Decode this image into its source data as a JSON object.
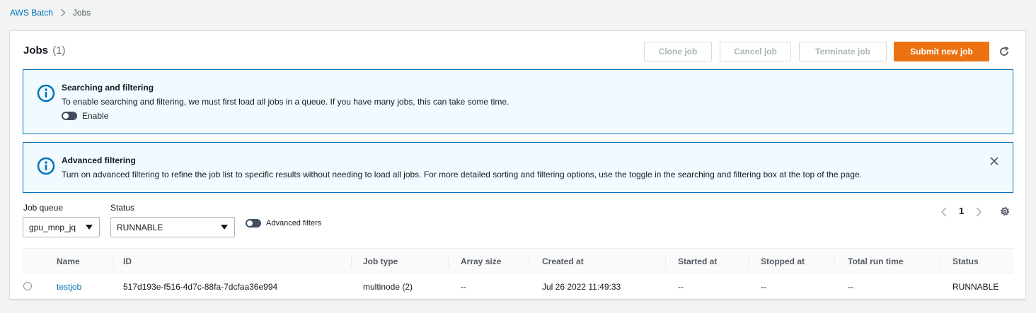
{
  "breadcrumb": {
    "root": "AWS Batch",
    "current": "Jobs"
  },
  "panel": {
    "title": "Jobs",
    "count": "(1)"
  },
  "buttons": {
    "clone": "Clone job",
    "cancel": "Cancel job",
    "terminate": "Terminate job",
    "submit": "Submit new job"
  },
  "alert_search": {
    "title": "Searching and filtering",
    "text": "To enable searching and filtering, we must first load all jobs in a queue. If you have many jobs, this can take some time.",
    "toggle_label": "Enable"
  },
  "alert_advanced": {
    "title": "Advanced filtering",
    "text": "Turn on advanced filtering to refine the job list to specific results without needing to load all jobs. For more detailed sorting and filtering options, use the toggle in the searching and filtering box at the top of the page."
  },
  "filters": {
    "job_queue_label": "Job queue",
    "job_queue_value": "gpu_mnp_jq",
    "status_label": "Status",
    "status_value": "RUNNABLE",
    "advanced_filters_label": "Advanced filters"
  },
  "pagination": {
    "page": "1"
  },
  "table": {
    "columns": [
      "Name",
      "ID",
      "Job type",
      "Array size",
      "Created at",
      "Started at",
      "Stopped at",
      "Total run time",
      "Status"
    ],
    "rows": [
      {
        "name": "testjob",
        "id": "517d193e-f516-4d7c-88fa-7dcfaa36e994",
        "job_type": "multinode (2)",
        "array_size": "--",
        "created_at": "Jul 26 2022 11:49:33",
        "started_at": "--",
        "stopped_at": "--",
        "total_run_time": "--",
        "status": "RUNNABLE"
      }
    ]
  },
  "colors": {
    "primary": "#ec7211",
    "link": "#0073bb",
    "info_bg": "#f1faff",
    "info_border": "#0073bb"
  }
}
